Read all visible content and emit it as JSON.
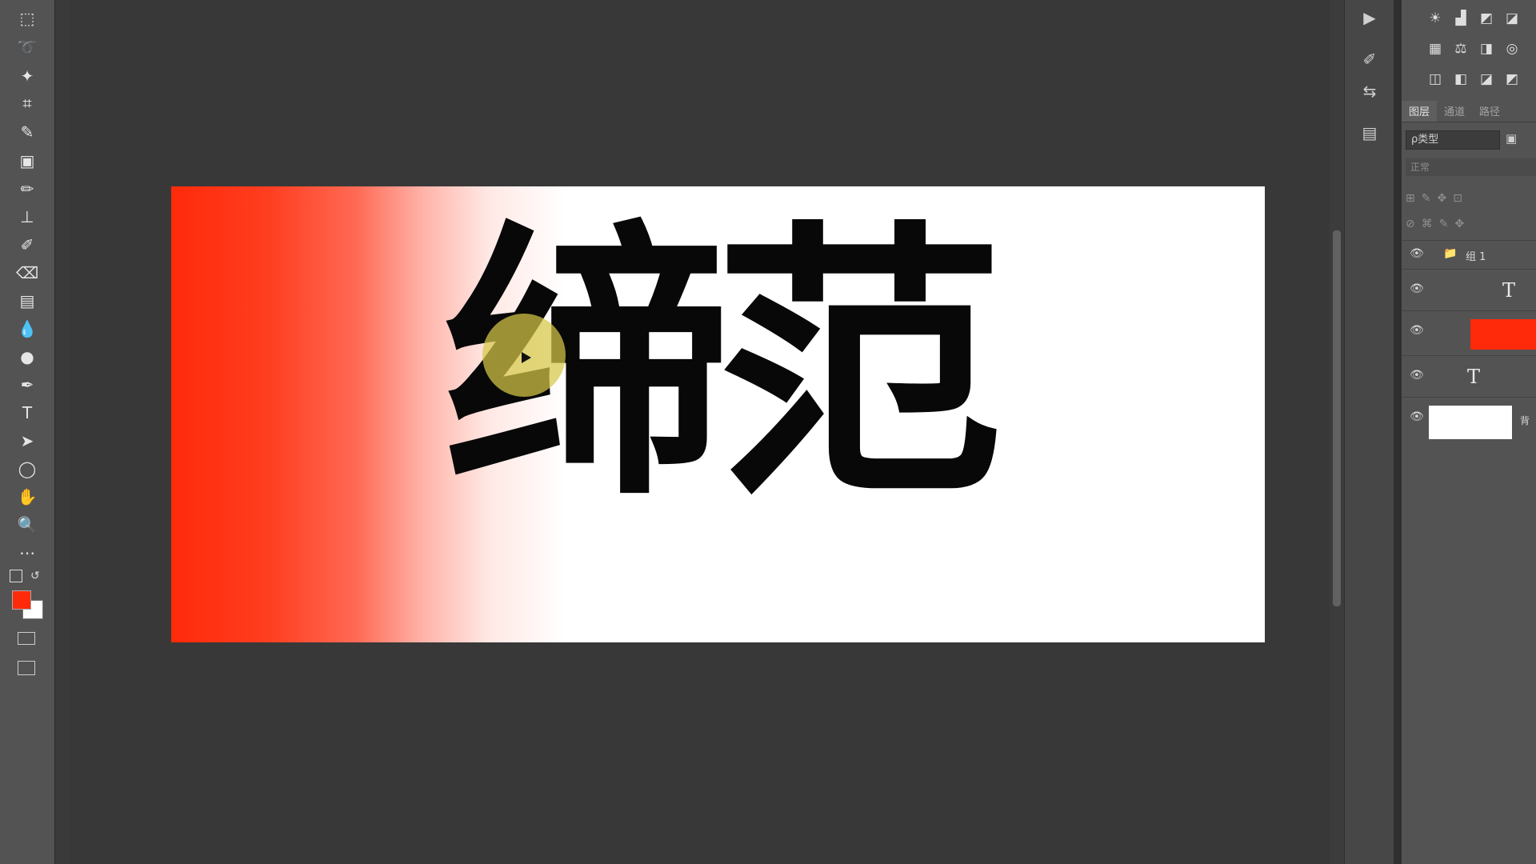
{
  "document": {
    "headline": "缔范",
    "gradient_color": "#ff2a0a",
    "background_color": "#ffffff"
  },
  "toolbar": {
    "tools": [
      {
        "name": "marquee-icon",
        "glyph": "⬚"
      },
      {
        "name": "lasso-icon",
        "glyph": "➰"
      },
      {
        "name": "magic-wand-icon",
        "glyph": "✦"
      },
      {
        "name": "crop-icon",
        "glyph": "⌗"
      },
      {
        "name": "eyedropper-icon",
        "glyph": "✎"
      },
      {
        "name": "healing-brush-icon",
        "glyph": "▣"
      },
      {
        "name": "brush-icon",
        "glyph": "✏"
      },
      {
        "name": "stamp-icon",
        "glyph": "⊥"
      },
      {
        "name": "history-brush-icon",
        "glyph": "✐"
      },
      {
        "name": "eraser-icon",
        "glyph": "⌫"
      },
      {
        "name": "gradient-icon",
        "glyph": "▤"
      },
      {
        "name": "blur-icon",
        "glyph": "💧"
      },
      {
        "name": "dodge-icon",
        "glyph": "●"
      },
      {
        "name": "pen-icon",
        "glyph": "✒"
      },
      {
        "name": "type-icon",
        "glyph": "T"
      },
      {
        "name": "path-selection-icon",
        "glyph": "➤"
      },
      {
        "name": "ellipse-icon",
        "glyph": "◯"
      },
      {
        "name": "hand-icon",
        "glyph": "✋"
      },
      {
        "name": "zoom-icon",
        "glyph": "🔍"
      },
      {
        "name": "more-tools-icon",
        "glyph": "⋯"
      }
    ],
    "foreground_color": "#ff2a0a",
    "background_color": "#ffffff"
  },
  "panels": {
    "tabs": [
      "图层",
      "通道",
      "路径"
    ],
    "filter_label": "ρ类型",
    "blend_label": "正常",
    "layers": {
      "group_name": "组 1",
      "text_icon": "T",
      "background_label": "背"
    },
    "adjustment_icons_row1": [
      "☀",
      "▟",
      "◩",
      "◪"
    ],
    "adjustment_icons_row2": [
      "▦",
      "⚖",
      "◨",
      "◎"
    ],
    "adjustment_icons_row3": [
      "◫",
      "◧",
      "◪",
      "◩"
    ]
  }
}
